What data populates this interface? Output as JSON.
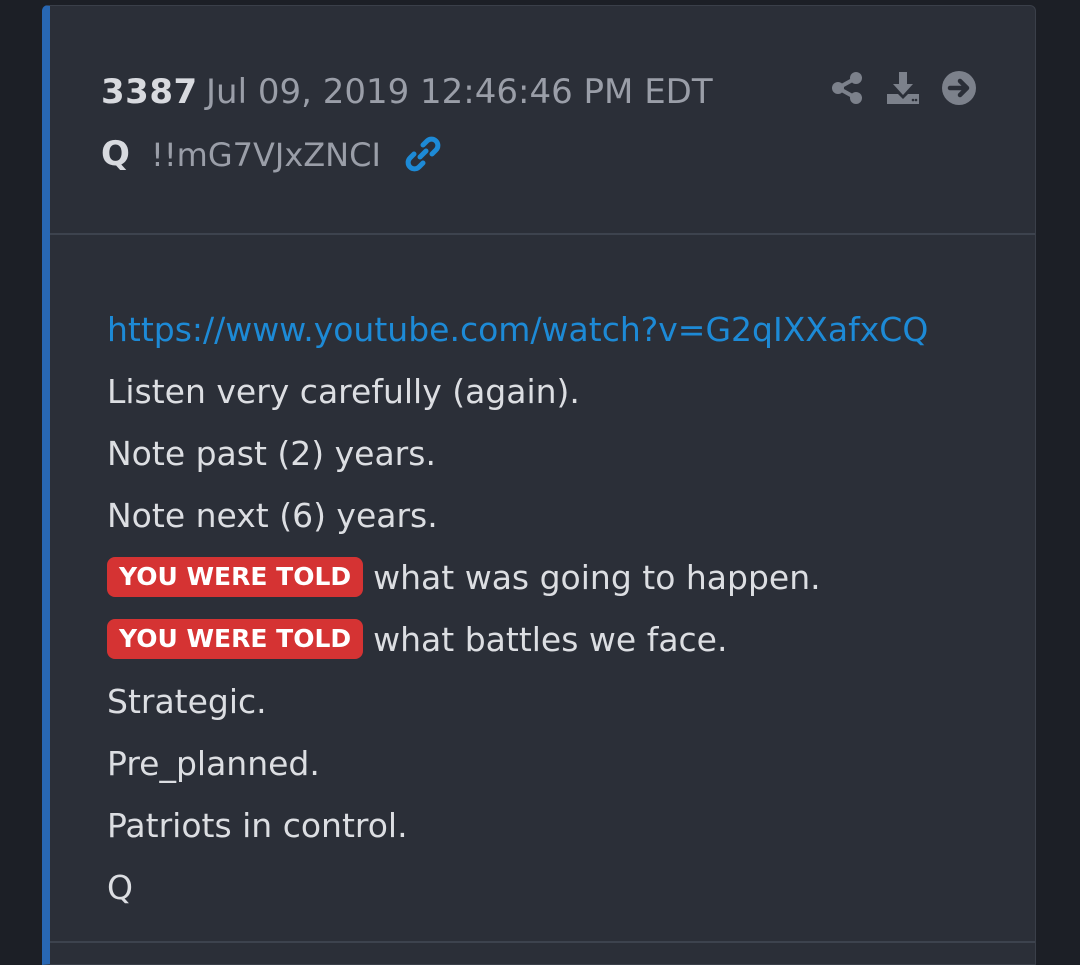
{
  "post": {
    "number": "3387",
    "date": "Jul 09, 2019 12:46:46 PM EDT",
    "author": "Q",
    "tripcode": "!!mG7VJxZNCI"
  },
  "colors": {
    "accent_bar": "#2867b3",
    "link": "#1d8ad6",
    "badge_bg": "#d53333",
    "card_bg": "#2b2f38"
  },
  "icons": {
    "link": "link-icon",
    "share": "share-icon",
    "download": "download-icon",
    "go": "arrow-circle-right-icon"
  },
  "body": {
    "url": "https://www.youtube.com/watch?v=G2qIXXafxCQ",
    "lines": [
      "Listen very carefully (again).",
      "Note past (2) years.",
      "Note next (6) years."
    ],
    "badge": "YOU WERE TOLD",
    "told_1": "what was going to happen.",
    "told_2": "what battles we face.",
    "lines_after": [
      "Strategic.",
      "Pre_planned.",
      "Patriots in control.",
      "Q"
    ]
  }
}
